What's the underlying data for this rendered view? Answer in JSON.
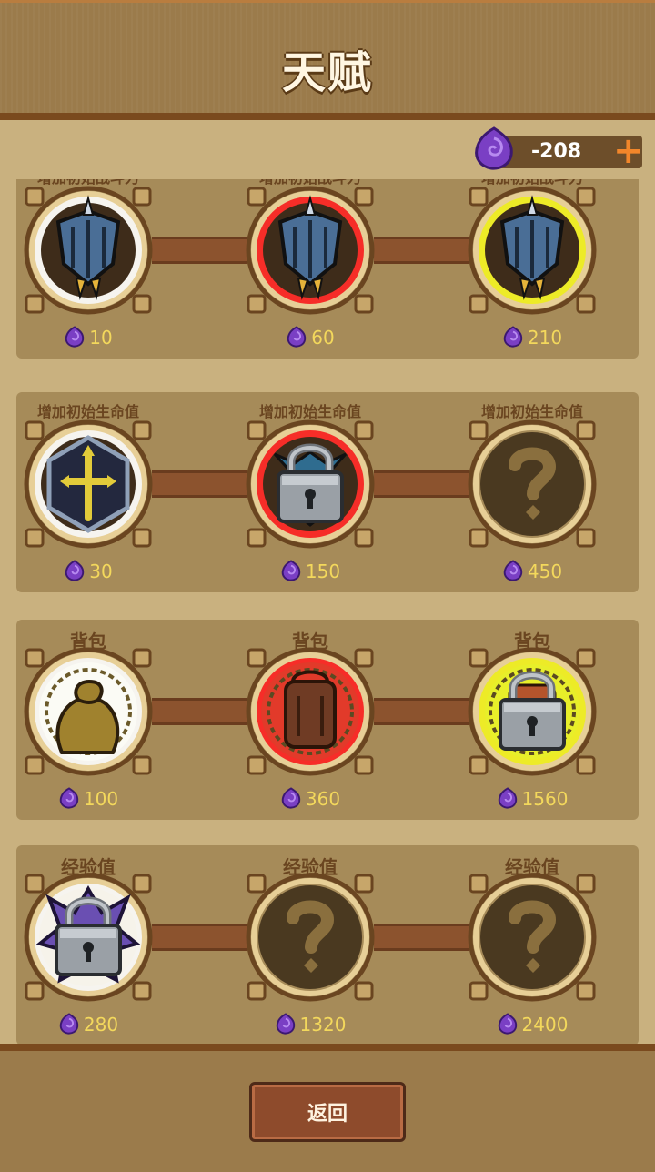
{
  "header": {
    "title": "天赋"
  },
  "currency": {
    "icon": "purple-gem-icon",
    "value": "-208",
    "add_icon": "plus-icon"
  },
  "rows": [
    {
      "nodes": [
        {
          "label": "增加初始战斗力",
          "cost": "10",
          "icon": "blue-shield-icon",
          "glow": "#ffffff",
          "locked": false
        },
        {
          "label": "增加初始战斗力",
          "cost": "60",
          "icon": "blue-shield-icon",
          "glow": "#ff2222",
          "locked": false
        },
        {
          "label": "增加初始战斗力",
          "cost": "210",
          "icon": "blue-shield-icon",
          "glow": "#f5f521",
          "locked": false
        }
      ]
    },
    {
      "nodes": [
        {
          "label": "增加初始生命值",
          "cost": "30",
          "icon": "cross-hexagon-icon",
          "glow": "#ffffff",
          "locked": false
        },
        {
          "label": "增加初始生命值",
          "cost": "150",
          "icon": "lock-icon",
          "glow": "#ff2222",
          "locked": true
        },
        {
          "label": "增加初始生命值",
          "cost": "450",
          "icon": "question-mark-icon",
          "glow": "",
          "locked": false
        }
      ]
    },
    {
      "nodes": [
        {
          "label": "背包",
          "cost": "100",
          "icon": "sack-icon",
          "glow": "#ffffff",
          "locked": false
        },
        {
          "label": "背包",
          "cost": "360",
          "icon": "backpack-icon",
          "glow": "#ff2222",
          "locked": false
        },
        {
          "label": "背包",
          "cost": "1560",
          "icon": "lock-icon",
          "glow": "#f5f521",
          "locked": true
        }
      ]
    },
    {
      "nodes": [
        {
          "label": "经验值",
          "cost": "280",
          "icon": "lock-icon",
          "glow": "#ffffff",
          "locked": true
        },
        {
          "label": "经验值",
          "cost": "1320",
          "icon": "question-mark-icon",
          "glow": "",
          "locked": false
        },
        {
          "label": "经验值",
          "cost": "2400",
          "icon": "question-mark-icon",
          "glow": "",
          "locked": false
        }
      ]
    }
  ],
  "footer": {
    "back_label": "返回"
  },
  "colors": {
    "gem": "#7a3fc4",
    "cost_text": "#f3d85c",
    "accent_plus": "#f2862a"
  }
}
